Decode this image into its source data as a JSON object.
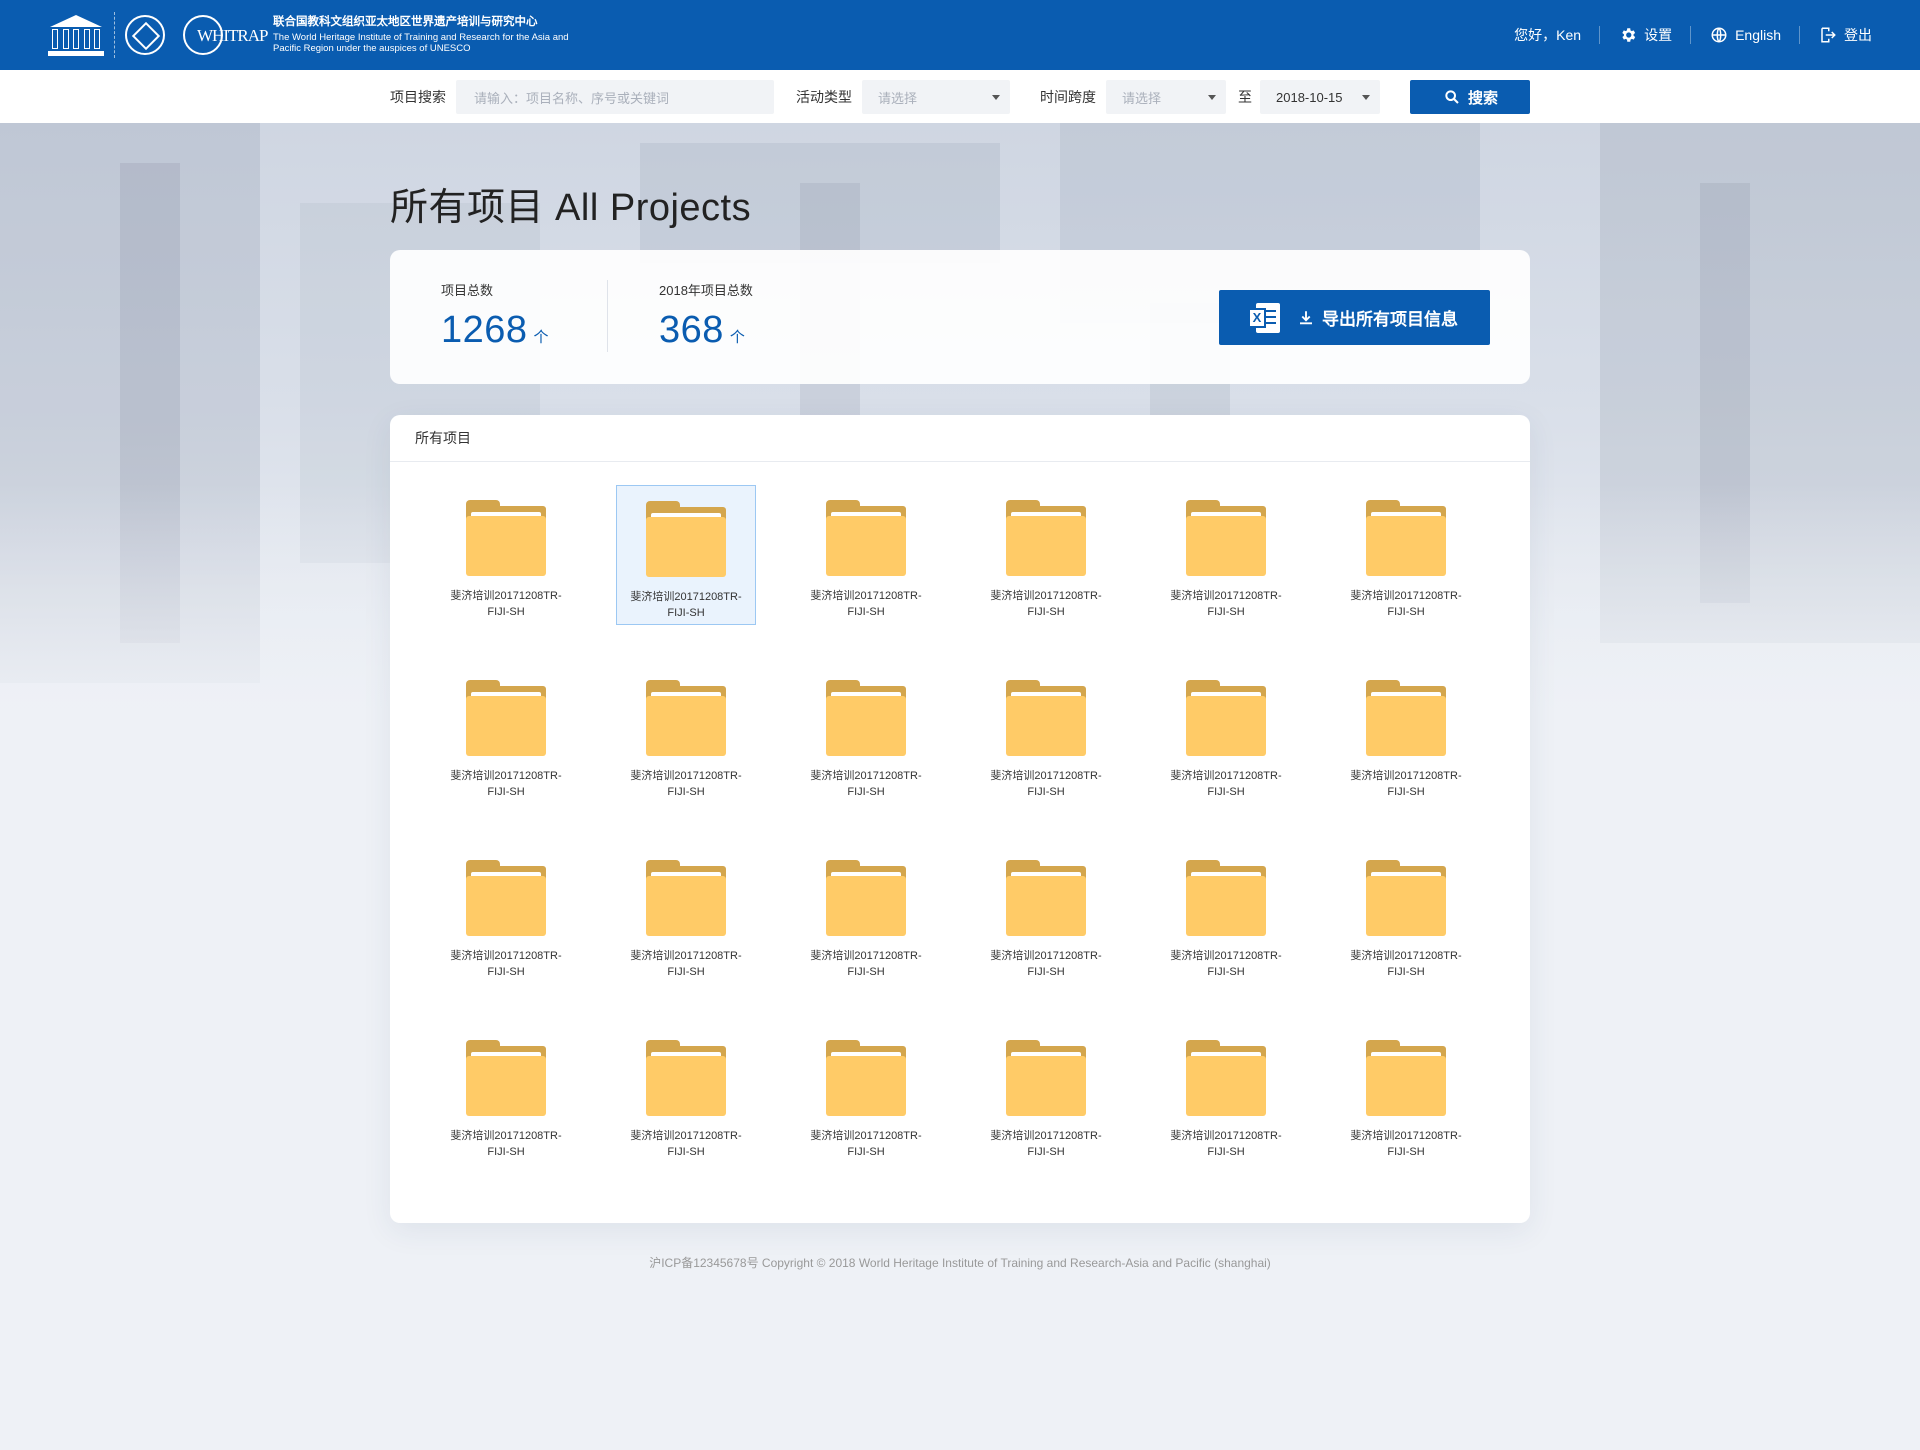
{
  "header": {
    "org_cn": "联合国教科文组织亚太地区世界遗产培训与研究中心",
    "org_en_line1": "The World Heritage Institute of Training and Research for the Asia and",
    "org_en_line2": "Pacific Region under the auspices of UNESCO",
    "whitrap_text": "WHITRAP",
    "greeting": "您好，Ken",
    "settings_label": "设置",
    "language_label": "English",
    "logout_label": "登出"
  },
  "search": {
    "project_label": "项目搜索",
    "project_placeholder": "请输入：项目名称、序号或关键词",
    "activity_label": "活动类型",
    "activity_value": "请选择",
    "time_label": "时间跨度",
    "time_from": "请选择",
    "to_label": "至",
    "time_to": "2018-10-15",
    "button_label": "搜索"
  },
  "page_title": "所有项目 All Projects",
  "stats": {
    "total_label": "项目总数",
    "total_value": "1268",
    "year_label": "2018年项目总数",
    "year_value": "368",
    "unit": "个",
    "export_label": "导出所有项目信息"
  },
  "projects": {
    "panel_title": "所有项目",
    "selected_index": 1,
    "items": [
      {
        "line1": "斐济培训20171208TR-",
        "line2": "FIJI-SH"
      },
      {
        "line1": "斐济培训20171208TR-",
        "line2": "FIJI-SH"
      },
      {
        "line1": "斐济培训20171208TR-",
        "line2": "FIJI-SH"
      },
      {
        "line1": "斐济培训20171208TR-",
        "line2": "FIJI-SH"
      },
      {
        "line1": "斐济培训20171208TR-",
        "line2": "FIJI-SH"
      },
      {
        "line1": "斐济培训20171208TR-",
        "line2": "FIJI-SH"
      },
      {
        "line1": "斐济培训20171208TR-",
        "line2": "FIJI-SH"
      },
      {
        "line1": "斐济培训20171208TR-",
        "line2": "FIJI-SH"
      },
      {
        "line1": "斐济培训20171208TR-",
        "line2": "FIJI-SH"
      },
      {
        "line1": "斐济培训20171208TR-",
        "line2": "FIJI-SH"
      },
      {
        "line1": "斐济培训20171208TR-",
        "line2": "FIJI-SH"
      },
      {
        "line1": "斐济培训20171208TR-",
        "line2": "FIJI-SH"
      },
      {
        "line1": "斐济培训20171208TR-",
        "line2": "FIJI-SH"
      },
      {
        "line1": "斐济培训20171208TR-",
        "line2": "FIJI-SH"
      },
      {
        "line1": "斐济培训20171208TR-",
        "line2": "FIJI-SH"
      },
      {
        "line1": "斐济培训20171208TR-",
        "line2": "FIJI-SH"
      },
      {
        "line1": "斐济培训20171208TR-",
        "line2": "FIJI-SH"
      },
      {
        "line1": "斐济培训20171208TR-",
        "line2": "FIJI-SH"
      },
      {
        "line1": "斐济培训20171208TR-",
        "line2": "FIJI-SH"
      },
      {
        "line1": "斐济培训20171208TR-",
        "line2": "FIJI-SH"
      },
      {
        "line1": "斐济培训20171208TR-",
        "line2": "FIJI-SH"
      },
      {
        "line1": "斐济培训20171208TR-",
        "line2": "FIJI-SH"
      },
      {
        "line1": "斐济培训20171208TR-",
        "line2": "FIJI-SH"
      },
      {
        "line1": "斐济培训20171208TR-",
        "line2": "FIJI-SH"
      }
    ]
  },
  "footer": "沪ICP备12345678号 Copyright © 2018 World Heritage Institute of Training and Research-Asia and Pacific (shanghai)",
  "colors": {
    "primary": "#0a5cb0",
    "folder": "#ffcb67",
    "background": "#eef1f6"
  },
  "icons": [
    "unesco-logo",
    "heritage-emblem",
    "whitrap-logo",
    "gear-icon",
    "globe-icon",
    "logout-icon",
    "search-icon",
    "chevron-down-icon",
    "excel-icon",
    "download-icon",
    "folder-icon"
  ]
}
